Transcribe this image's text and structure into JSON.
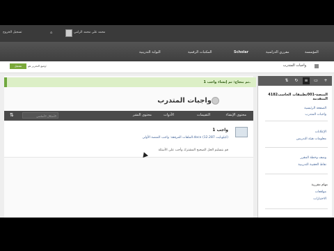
{
  "topbar": {
    "user_name": "محمد علي محمد الرامي",
    "logout_label": "تسجيل الخروج"
  },
  "nav": {
    "items": [
      "المؤسسة",
      "مقرري الدراسية",
      "Scholar",
      "المكتبات الرقمية",
      "البوابة التدريبية"
    ]
  },
  "crumb": {
    "current": "واجبات المتدرب",
    "edit_button": "تشغيل",
    "edit_mode": "وضع التحرير هو:"
  },
  "main": {
    "notice": "تم بنجاح: تم إنشاء واجب 1.",
    "title": "واجبات المتدرب",
    "toolbar": {
      "buttons": [
        "محتوى الإنشاء",
        "التقييمات",
        "الأدوات",
        "محتوى النشر"
      ],
      "search_placeholder": "الأشكال الأساسي"
    },
    "item": {
      "title": "واجب 1",
      "attachment": "الملفات المرفقة: واجب المنصة الأولى.docx (12.287 كيلوبايت)",
      "description": "قم بتسليم الحل الصحيح المشترك وأجب على الأسئلة"
    }
  },
  "sidebar": {
    "course": "4182المنصة-001تطبيقات الحاسب\nالمتقدمة",
    "links": [
      "الصفحة الرئيسية",
      "واجبات المتدرب",
      "الإعلانات",
      "معلومات هيئة التدريس",
      "وصف وخطة المقرر",
      "نقاط الحقيبة التدريبية",
      "مهام مقررية",
      "مواقعات",
      "الاختبارات"
    ]
  },
  "icons": {
    "tools": [
      "add-icon",
      "folder-icon",
      "refresh-icon",
      "grid-icon",
      "sort-icon"
    ]
  }
}
